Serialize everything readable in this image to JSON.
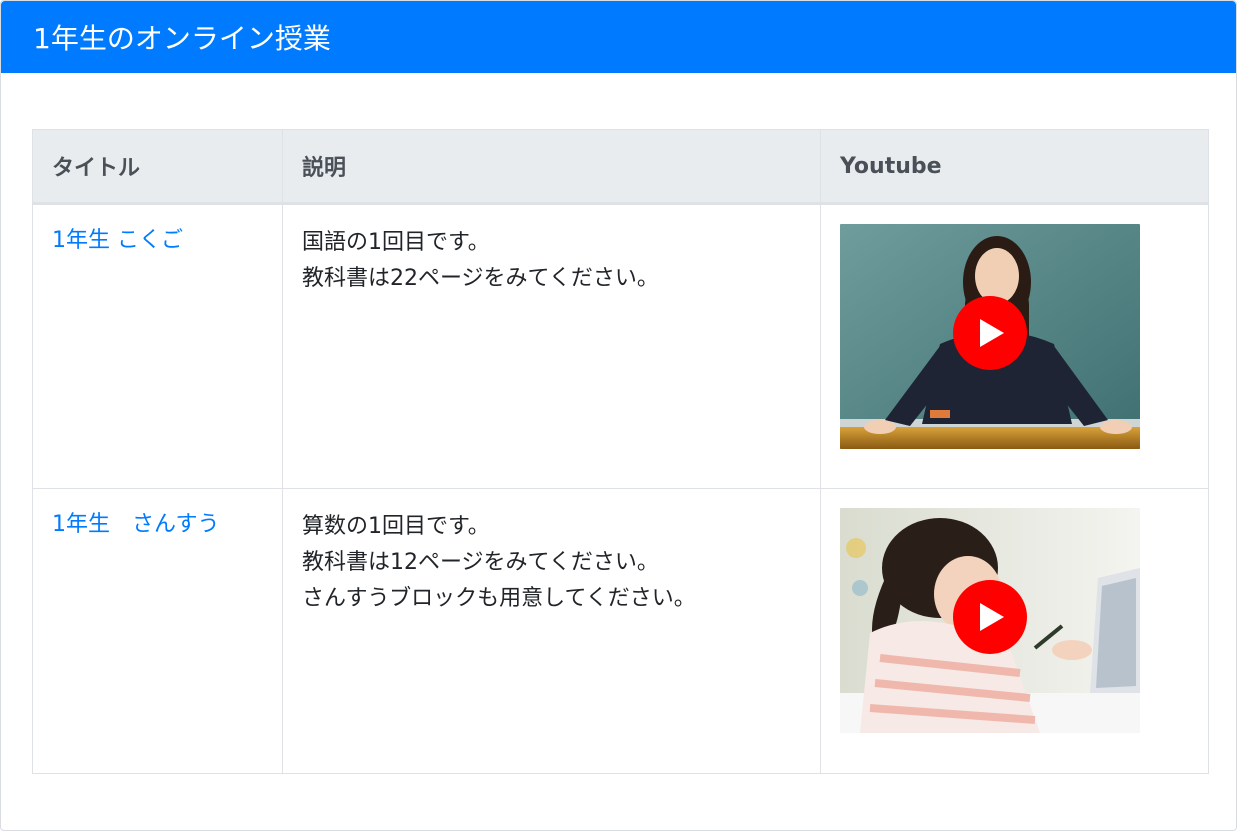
{
  "header": {
    "title": "1年生のオンライン授業"
  },
  "table": {
    "columns": [
      "タイトル",
      "説明",
      "Youtube"
    ],
    "rows": [
      {
        "title": "1年生 こくご",
        "description": [
          "国語の1回目です。",
          "教科書は22ページをみてください。"
        ],
        "thumbnail": "teacher-video-thumbnail"
      },
      {
        "title": "1年生　さんすう",
        "description": [
          "算数の1回目です。",
          "教科書は12ページをみてください。",
          "さんすうブロックも用意してください。"
        ],
        "thumbnail": "student-video-thumbnail"
      }
    ]
  },
  "colors": {
    "header_bg": "#007bff",
    "link": "#007bff",
    "play": "#ff0000"
  },
  "icons": {
    "play": "youtube-play-icon"
  }
}
